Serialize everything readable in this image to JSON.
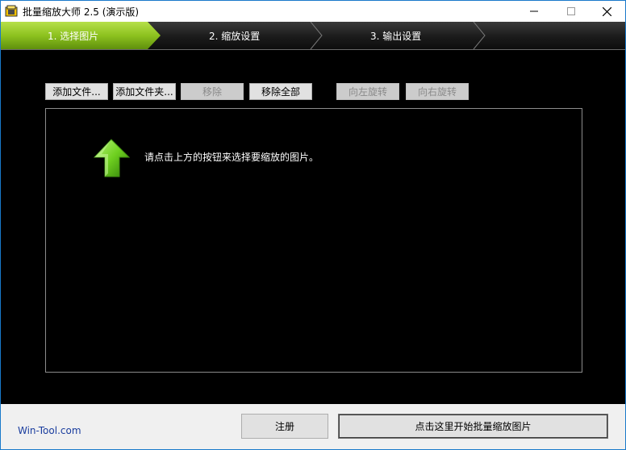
{
  "window": {
    "title": "批量缩放大师 2.5 (演示版)"
  },
  "steps": [
    {
      "label": "1. 选择图片",
      "active": true
    },
    {
      "label": "2. 缩放设置",
      "active": false
    },
    {
      "label": "3. 输出设置",
      "active": false
    }
  ],
  "toolbar": {
    "add_file": "添加文件...",
    "add_folder": "添加文件夹...",
    "remove": "移除",
    "remove_all": "移除全部",
    "rotate_left": "向左旋转",
    "rotate_right": "向右旋转"
  },
  "file_area": {
    "hint": "请点击上方的按钮来选择要缩放的图片。",
    "hint_icon": "up-arrow-icon"
  },
  "footer": {
    "site": "Win-Tool.com",
    "register": "注册",
    "start": "点击这里开始批量缩放图片"
  },
  "colors": {
    "active_step": "#8dc21f",
    "accent_arrow": "#6fd020",
    "link": "#1a3d9e"
  }
}
